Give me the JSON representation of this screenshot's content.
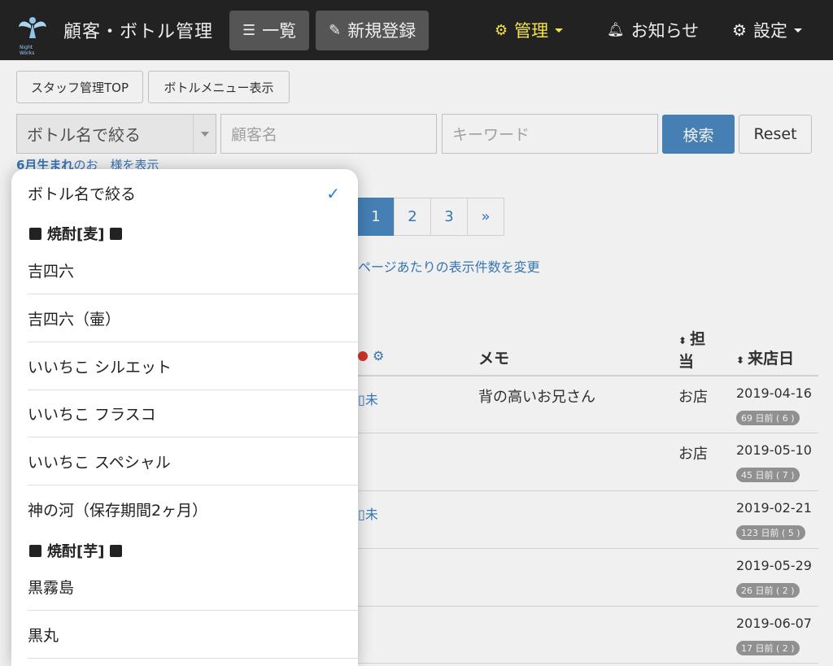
{
  "navbar": {
    "logo_text": "Night Works",
    "brand": "顧客・ボトル管理",
    "list_label": "一覧",
    "new_label": "新規登録",
    "admin_label": "管理",
    "notice_label": "お知らせ",
    "settings_label": "設定",
    "colors": {
      "bg": "#222222",
      "admin": "#f2e44a"
    }
  },
  "toolbar": {
    "staff_top": "スタッフ管理TOP",
    "bottle_menu": "ボトルメニュー表示"
  },
  "search": {
    "bottle_select_value": "ボトル名で絞る",
    "customer_placeholder": "顧客名",
    "keyword_placeholder": "キーワード",
    "search_label": "検索",
    "reset_label": "Reset",
    "june_link_bold": "6月生まれ",
    "june_link_rest": "のお　様を表示"
  },
  "pagination": {
    "pages": [
      "1",
      "2",
      "3",
      "»"
    ],
    "current": "1",
    "per_page_link": "ページあたりの表示件数を変更"
  },
  "table": {
    "headers": {
      "memo": "メモ",
      "tanto": "担当",
      "raiten": "来店日"
    },
    "rows": [
      {
        "mark": "未",
        "memo": "背の高いお兄さん",
        "tanto": "お店",
        "date": "2019-04-16",
        "badge": "69 日前 ( 6 )"
      },
      {
        "mark": "",
        "memo": "",
        "tanto": "お店",
        "date": "2019-05-10",
        "badge": "45 日前 ( 7 )"
      },
      {
        "mark": "未",
        "memo": "",
        "tanto": "",
        "date": "2019-02-21",
        "badge": "123 日前 ( 5 )"
      },
      {
        "mark": "",
        "memo": "",
        "tanto": "",
        "date": "2019-05-29",
        "badge": "26 日前 ( 2 )"
      },
      {
        "mark": "",
        "memo": "",
        "tanto": "",
        "date": "2019-06-07",
        "badge": "17 日前 ( 2 )"
      }
    ]
  },
  "dropdown": {
    "selected": "ボトル名で絞る",
    "group1": "焼酎[麦]",
    "group1_items": [
      "吉四六",
      "吉四六（壷）",
      "いいちこ シルエット",
      "いいちこ フラスコ",
      "いいちこ スペシャル",
      "神の河（保存期間2ヶ月）"
    ],
    "group2": "焼酎[芋]",
    "group2_items": [
      "黒霧島",
      "黒丸"
    ],
    "check_color": "#2f7be0"
  }
}
